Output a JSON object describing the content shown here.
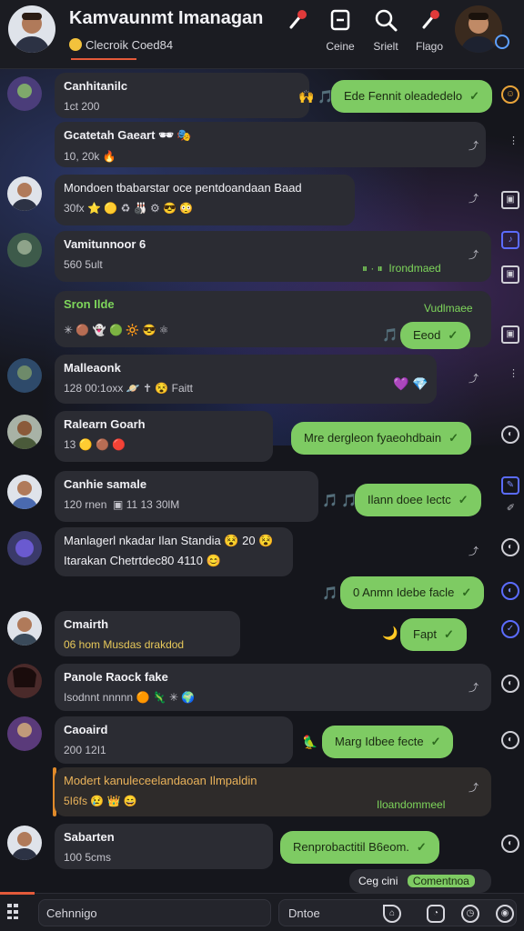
{
  "header": {
    "title": "Kamvaunmt Imanagan",
    "subtitle": "Clecroik Coed84",
    "tools": [
      {
        "label": "",
        "icon": "microphone-icon"
      },
      {
        "label": "Ceine",
        "icon": "square-icon"
      },
      {
        "label": "Srielt",
        "icon": "search-icon"
      },
      {
        "label": "Flago",
        "icon": "microphone-icon"
      }
    ]
  },
  "messages": [
    {
      "name": "Canhitanilc",
      "meta": "1ct 200",
      "out_text": "Ede Fennit oleadedelo",
      "reactions": "🙌 🎵"
    },
    {
      "name": "Gcatetah Gaeart",
      "meta": "10, 20k",
      "meta_emoji": "🔥",
      "name_emojis": "🕶 🎭"
    },
    {
      "text": "Mondoen tbabarstar oce pentdoandaan Baad",
      "meta": "30fx",
      "meta_emojis": "⭐ 🟡 ♻ 🎳 ⚙ 😎 😳"
    },
    {
      "name": "Vamitunnoor 6",
      "meta": "560 5ult",
      "green_meta": "Irondmaed",
      "green_icons": "⏸ · ⏸"
    },
    {
      "name": "Sron Ilde",
      "meta_emojis": "✳ 🟤 👻 🟢 🔆 😎 ⚛",
      "green_meta": "Vudlmaee",
      "out_text": "Eeod",
      "reactions": "🎵"
    },
    {
      "name": "Malleaonk",
      "meta": "128 00:1oxx",
      "meta_emojis": "🪐 ✝ 😵 Faitt",
      "reactions": "💜 💎"
    },
    {
      "name": "Ralearn Goarh",
      "meta": "13",
      "meta_emojis": "🟡 🟤 🔴",
      "out_text": "Mre dergleon fyaeohdbain"
    },
    {
      "name": "Canhie samale",
      "meta": "120 rnen",
      "meta2": "11 13 30lM",
      "out_text": "Ilann doee Iectc",
      "reactions": "🎵 🎵"
    },
    {
      "text": "Manlagerl nkadar Ilan Standia",
      "text2": "Itarakan Chetrtdec80 4110",
      "text_emojis": "😵 20 😵",
      "text2_emoji": "😊"
    },
    {
      "out_text": "0 Anmn Idebe facle",
      "reactions": "🎵"
    },
    {
      "name": "Cmairth",
      "meta": "06 hom",
      "meta2": "Musdas drakdod",
      "out_text": "Fapt",
      "reactions": "🌙"
    },
    {
      "name": "Panole Raock fake",
      "meta": "Isodnnt",
      "meta2": "nnnnn",
      "meta_emojis": "🟠 🦎 ✳ 🌍"
    },
    {
      "name": "Caoaird",
      "meta": "200 12I1",
      "out_text": "Marg Idbee fecte",
      "reactions": "🦜"
    },
    {
      "text": "Modert kanuleceelandaoan Ilmpaldin",
      "meta": "5I6fs",
      "meta_emojis": "😢 👑 😄",
      "green_meta": "Iloandommeel"
    },
    {
      "name": "Sabarten",
      "meta": "100 5cms",
      "out_text": "Renprobactitil B6eom."
    },
    {
      "small_text": "Ceg cini",
      "out_text": "Comentnoa"
    }
  ],
  "composer": {
    "placeholder": "Cehnnigo",
    "second_label": "Dntoe"
  }
}
